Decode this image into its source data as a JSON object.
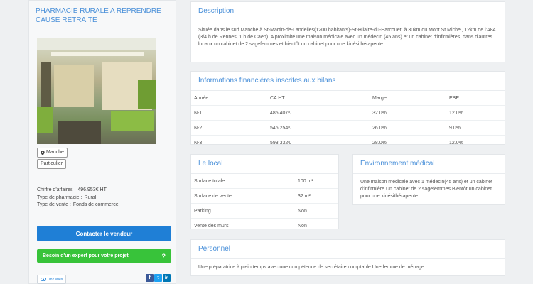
{
  "listing": {
    "title": "PHARMACIE RURALE A REPRENDRE CAUSE RETRAITE",
    "tags": [
      "Manche",
      "Particulier"
    ],
    "facts": [
      {
        "label": "Chiffre d'affaires :",
        "value": "496.953€ HT"
      },
      {
        "label": "Type de pharmacie :",
        "value": "Rural"
      },
      {
        "label": "Type de vente :",
        "value": "Fonds de commerce"
      }
    ],
    "contact_button": "Contacter le vendeur",
    "expert_button": "Besoin d'un expert pour votre projet",
    "expert_icon": "?",
    "views": "782 vues",
    "social": [
      "f",
      "t",
      "in"
    ]
  },
  "description": {
    "title": "Description",
    "text": "Située dans le sud Manche à St-Martin-de-Landelles(1200 habitants)-St-Hilaire-du-Harcouet, à 30km du Mont St Michel, 12km de l'A84 (3/4 h de Rennes, 1 h de Caen). A proximité une maison médicale avec un médecin (45 ans) et un cabinet d'infirmières, dans d'autres locaux un cabinet de 2 sagefemmes et bientôt un cabinet pour une kinésithérapeute"
  },
  "finance": {
    "title": "Informations financières inscrites aux bilans",
    "headers": [
      "Année",
      "CA HT",
      "Marge",
      "EBE"
    ],
    "rows": [
      [
        "N-1",
        "485.407€",
        "32.0%",
        "12.0%"
      ],
      [
        "N-2",
        "546.254€",
        "26.0%",
        "9.0%"
      ],
      [
        "N-3",
        "593.332€",
        "28.0%",
        "12.0%"
      ]
    ]
  },
  "local": {
    "title": "Le local",
    "rows": [
      [
        "Surface totale",
        "100 m²"
      ],
      [
        "Surface de vente",
        "32 m²"
      ],
      [
        "Parking",
        "Non"
      ],
      [
        "Vente des murs",
        "Non"
      ]
    ]
  },
  "environment": {
    "title": "Environnement médical",
    "text": "Une maison médicale avec 1 médecin(45 ans) et un cabinet d'infirmière Un cabinet de 2 sagefemmes Bientôt un cabinet pour une kinésithérapeute"
  },
  "personnel": {
    "title": "Personnel",
    "text": "Une préparatrice à plein temps avec une compétence de secrétaire comptable Une femme de ménage"
  },
  "colors": {
    "accent": "#4a90d9",
    "contact": "#1f7fd6",
    "expert": "#38c33a"
  }
}
